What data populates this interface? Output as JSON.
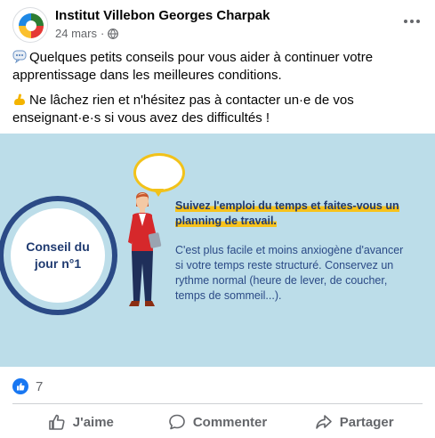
{
  "post": {
    "page_name": "Institut Villebon Georges Charpak",
    "date": "24 mars",
    "date_separator": "·",
    "audience_icon": "globe-icon",
    "lines": [
      "Quelques petits conseils pour vous aider à continuer votre apprentissage dans les meilleures conditions.",
      "Ne lâchez rien et n'hésitez pas à contacter un·e de vos enseignant·e·s si vous avez des difficultés !"
    ]
  },
  "media": {
    "tip_label": "Conseil du jour n°1",
    "headline": "Suivez l'emploi du temps et faites-vous un planning de travail.",
    "body": "C'est plus facile et moins anxiogène d'avancer si votre temps reste structuré. Conservez un rythme normal (heure de lever, de coucher, temps de sommeil...).",
    "colors": {
      "background": "#bcdde9",
      "navy": "#2b4a86",
      "accent": "#f7c21b"
    }
  },
  "reactions": {
    "count": "7",
    "icon": "like-icon"
  },
  "actions": {
    "like": "J'aime",
    "comment": "Commenter",
    "share": "Partager"
  }
}
